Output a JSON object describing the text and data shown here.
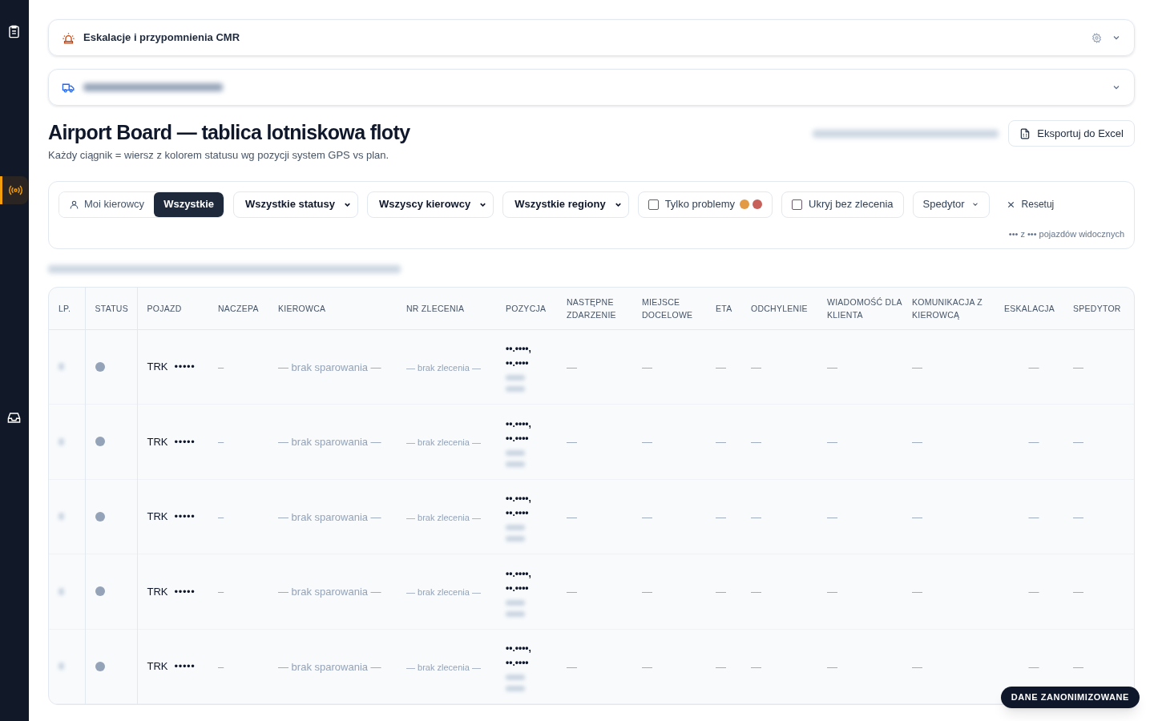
{
  "sidebar": {
    "items": [
      {
        "selected": false
      },
      {
        "selected": true
      },
      {
        "selected": false
      }
    ]
  },
  "panels": [
    {
      "kind": "titled",
      "title": "Eskalacje i przypomnienia CMR"
    },
    {
      "kind": "blurred"
    }
  ],
  "header": {
    "title": "Airport Board — tablica lotniskowa floty",
    "subtitle": "Każdy ciągnik = wiersz z kolorem statusu wg pozycji system GPS vs plan.",
    "export_button": "Eksportuj do Excel"
  },
  "filters": {
    "scope_toggle": [
      {
        "label": "Moi kierowcy",
        "selected": false
      },
      {
        "label": "Wszystkie",
        "selected": true
      }
    ],
    "selects": [
      "Wszystkie statusy",
      "Wszyscy kierowcy",
      "Wszystkie regiony"
    ],
    "checkboxes": [
      {
        "label": "Tylko problemy",
        "checked": false,
        "dots": [
          {
            "color": "#e39a45"
          },
          {
            "color": "#c8605a"
          }
        ]
      },
      {
        "label": "Ukryj bez zlecenia",
        "checked": false
      }
    ],
    "forwarder": "Spedytor",
    "reset": "Resetuj",
    "visible_count": "••• z ••• pojazdów widocznych"
  },
  "table": {
    "columns": [
      "LP.",
      "STATUS",
      "POJAZD",
      "NACZEPA",
      "KIEROWCA",
      "NR ZLECENIA",
      "POZYCJA",
      "NASTĘPNE ZDARZENIE",
      "MIEJSCE DOCELOWE",
      "ETA",
      "ODCHYLENIE",
      "WIADOMOŚĆ DLA KLIENTA",
      "KOMUNIKACJA Z KIEROWCĄ",
      "ESKALACJA",
      "SPEDYTOR"
    ],
    "rows": [
      {
        "color": "#94a3b8",
        "vehicle": "TRK",
        "vehicle_id": "•••••",
        "trailer": "–",
        "driver": "— brak sparowania —",
        "order": "— brak zlecenia —",
        "position": [
          "••.••••,",
          "••.••••"
        ],
        "next_event": "—",
        "destination": "—",
        "eta": "—",
        "deviation": "—",
        "client_message": "—",
        "driver_comm": "—",
        "escalation": "—",
        "forwarder": "—"
      },
      {
        "color": "#94a3b8",
        "vehicle": "TRK",
        "vehicle_id": "•••••",
        "trailer": "–",
        "driver": "— brak sparowania —",
        "order": "— brak zlecenia —",
        "position": [
          "••.••••,",
          "••.••••"
        ],
        "next_event": "—",
        "destination": "—",
        "eta": "—",
        "deviation": "—",
        "client_message": "—",
        "driver_comm": "—",
        "escalation": "—",
        "forwarder": "—"
      },
      {
        "color": "#94a3b8",
        "vehicle": "TRK",
        "vehicle_id": "•••••",
        "trailer": "–",
        "driver": "— brak sparowania —",
        "order": "— brak zlecenia —",
        "position": [
          "••.••••,",
          "••.••••"
        ],
        "next_event": "—",
        "destination": "—",
        "eta": "—",
        "deviation": "—",
        "client_message": "—",
        "driver_comm": "—",
        "escalation": "—",
        "forwarder": "—"
      },
      {
        "color": "#94a3b8",
        "vehicle": "TRK",
        "vehicle_id": "•••••",
        "trailer": "–",
        "driver": "— brak sparowania —",
        "order": "— brak zlecenia —",
        "position": [
          "••.••••,",
          "••.••••"
        ],
        "next_event": "—",
        "destination": "—",
        "eta": "—",
        "deviation": "—",
        "client_message": "—",
        "driver_comm": "—",
        "escalation": "—",
        "forwarder": "—"
      },
      {
        "color": "#94a3b8",
        "vehicle": "TRK",
        "vehicle_id": "•••••",
        "trailer": "–",
        "driver": "— brak sparowania —",
        "order": "— brak zlecenia —",
        "position": [
          "••.••••,",
          "••.••••"
        ],
        "next_event": "—",
        "destination": "—",
        "eta": "—",
        "deviation": "—",
        "client_message": "—",
        "driver_comm": "—",
        "escalation": "—",
        "forwarder": "—"
      }
    ]
  },
  "badge": "DANE ZANONIMIZOWANE"
}
